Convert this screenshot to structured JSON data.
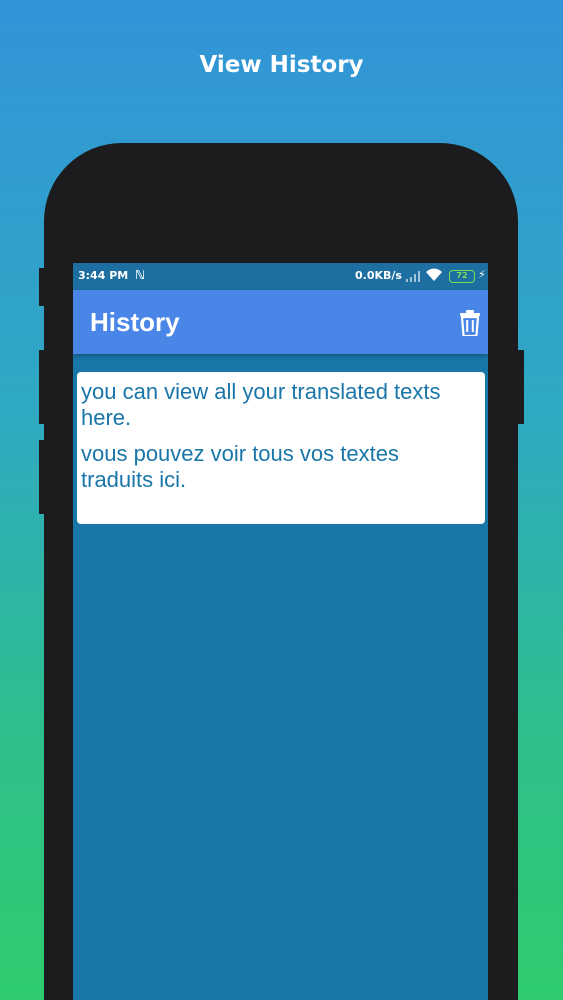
{
  "promo": {
    "title": "View History"
  },
  "status_bar": {
    "time": "3:44 PM",
    "notification_icon": "n-icon",
    "data_rate": "0.0KB/s",
    "battery_level": "72"
  },
  "app_bar": {
    "title": "History",
    "delete_icon": "trash-icon"
  },
  "history": {
    "items": [
      {
        "source_text": "you can view all your translated texts here.",
        "translated_text": "vous pouvez voir tous vos textes traduits ici."
      }
    ]
  },
  "colors": {
    "app_bar": "#4a86e8",
    "screen_background": "#1976a9",
    "card_background": "#ffffff",
    "text_color": "#1976a9",
    "battery": "#7ddc5a"
  }
}
